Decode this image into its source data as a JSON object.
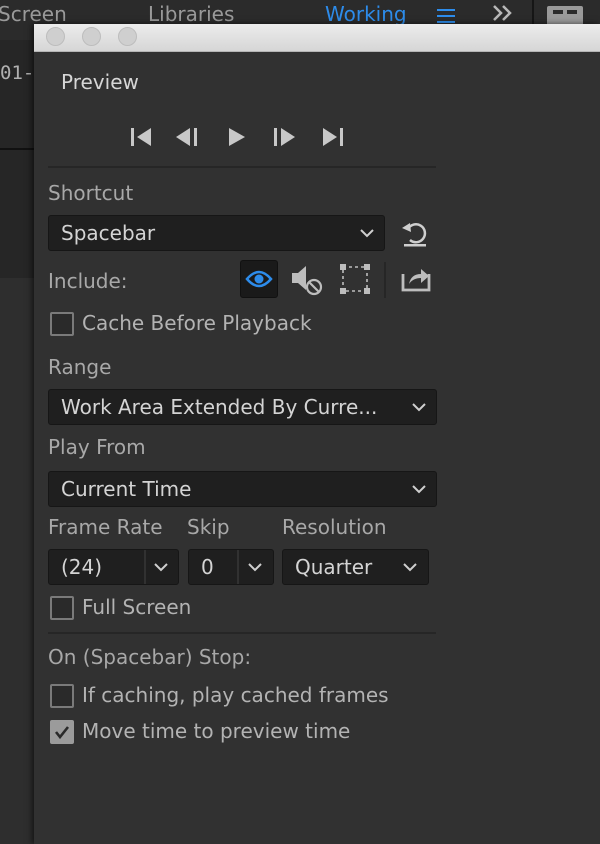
{
  "background": {
    "tabs": [
      {
        "label": "Screen"
      },
      {
        "label": "Libraries"
      },
      {
        "label": "Working"
      }
    ],
    "timecode_fragment": "01-",
    "accent_color": "#2d8ceb"
  },
  "panel": {
    "title": "Preview",
    "transport": [
      "first-frame-icon",
      "previous-frame-icon",
      "play-icon",
      "next-frame-icon",
      "last-frame-icon"
    ],
    "shortcut": {
      "label": "Shortcut",
      "value": "Spacebar"
    },
    "include": {
      "label": "Include:",
      "video_active": true
    },
    "cache_before_playback": {
      "label": "Cache Before Playback",
      "checked": false
    },
    "range": {
      "label": "Range",
      "value": "Work Area Extended By Curre..."
    },
    "play_from": {
      "label": "Play From",
      "value": "Current Time"
    },
    "frame_rate": {
      "label": "Frame Rate",
      "value": "(24)"
    },
    "skip": {
      "label": "Skip",
      "value": "0"
    },
    "resolution": {
      "label": "Resolution",
      "value": "Quarter"
    },
    "full_screen": {
      "label": "Full Screen",
      "checked": false
    },
    "stop": {
      "label": "On (Spacebar) Stop:",
      "if_caching": {
        "label": "If caching, play cached frames",
        "checked": false
      },
      "move_time": {
        "label": "Move time to preview time",
        "checked": true
      }
    }
  }
}
